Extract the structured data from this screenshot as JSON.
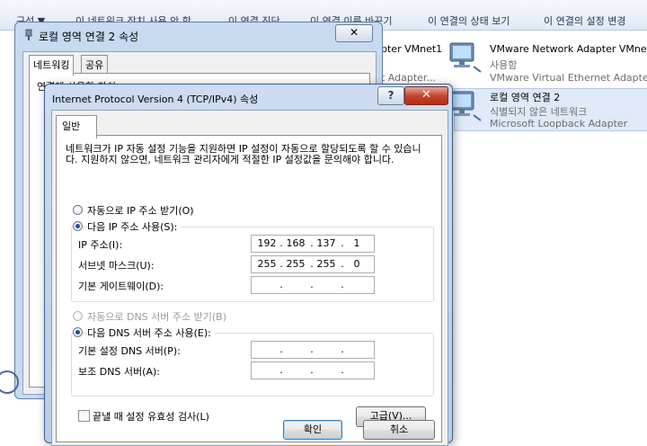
{
  "background_window": {
    "toolbar": [
      "구성 ▼",
      "이 네트워크 장치 사용 안 함",
      "이 연결 진단",
      "이 연결 이름 바꾸기",
      "이 연결의 상태 보기",
      "이 연결의 설정 변경"
    ],
    "adapters": [
      {
        "name": "pter VMnet1",
        "sub": "t Adapter..."
      },
      {
        "name": "VMware Network Adapter VMnet2",
        "status": "사용함",
        "sub": "VMware Virtual Ethernet Adapter..."
      },
      {
        "name": "로컬 영역 연결 2",
        "status": "식별되지 않은 네트워크",
        "sub": "Microsoft Loopback Adapter"
      }
    ]
  },
  "properties_window": {
    "title": "로컬 영역 연결 2 속성",
    "tabs": [
      "네트워킹",
      "공유"
    ],
    "connect_label": "연결에 사용할 장치:"
  },
  "dialog": {
    "title": "Internet Protocol Version 4 (TCP/IPv4) 속성",
    "help_label": "?",
    "close_label": "✕",
    "tab": "일반",
    "description": "네트워크가 IP 자동 설정 기능을 지원하면 IP 설정이 자동으로 할당되도록 할 수 있습니다. 지원하지 않으면, 네트워크 관리자에게 적절한 IP 설정값을 문의해야 합니다.",
    "ip_auto_label": "자동으로 IP 주소 받기(O)",
    "ip_manual_label": "다음 IP 주소 사용(S):",
    "ip_fields": [
      {
        "label": "IP 주소(I):",
        "octets": [
          "192",
          "168",
          "137",
          "1"
        ]
      },
      {
        "label": "서브넷 마스크(U):",
        "octets": [
          "255",
          "255",
          "255",
          "0"
        ]
      },
      {
        "label": "기본 게이트웨이(D):",
        "octets": [
          "",
          "",
          "",
          ""
        ]
      }
    ],
    "dns_auto_label": "자동으로 DNS 서버 주소 받기(B)",
    "dns_manual_label": "다음 DNS 서버 주소 사용(E):",
    "dns_fields": [
      {
        "label": "기본 설정 DNS 서버(P):",
        "octets": [
          "",
          "",
          "",
          ""
        ]
      },
      {
        "label": "보조 DNS 서버(A):",
        "octets": [
          "",
          "",
          "",
          ""
        ]
      }
    ],
    "validate_label": "끝낼 때 설정 유효성 검사(L)",
    "advanced_label": "고급(V)...",
    "ok_label": "확인",
    "cancel_label": "취소"
  }
}
